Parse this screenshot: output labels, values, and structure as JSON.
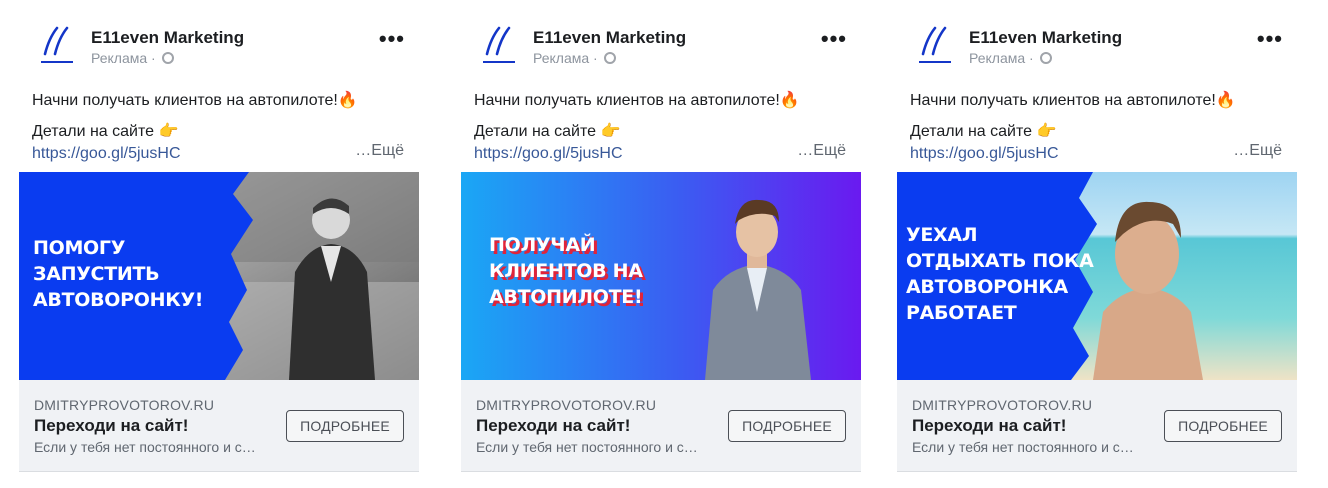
{
  "colors": {
    "brand_blue": "#0a3cf0",
    "link": "#385898",
    "secondary_text": "#606770",
    "cta_background": "#f0f2f5"
  },
  "ads": [
    {
      "advertiser": "E11even Marketing",
      "sponsored_label": "Реклама ·",
      "body_line1": "Начни получать клиентов на автопилоте!🔥",
      "body_line2": "Детали на сайте 👉",
      "link": "https://goo.gl/5jusHC",
      "see_more": "…Ещё",
      "image_headline": [
        "ПОМОГУ",
        "ЗАПУСТИТЬ",
        "АВТОВОРОНКУ!"
      ],
      "domain": "DMITRYPROVOTOROV.RU",
      "cta_title": "Переходи на сайт!",
      "cta_description": "Если у тебя нет постоянного и с…",
      "cta_button": "ПОДРОБНЕЕ",
      "more_icon": "ellipsis-icon"
    },
    {
      "advertiser": "E11even Marketing",
      "sponsored_label": "Реклама ·",
      "body_line1": "Начни получать клиентов на автопилоте!🔥",
      "body_line2": "Детали на сайте 👉",
      "link": "https://goo.gl/5jusHC",
      "see_more": "…Ещё",
      "image_headline": [
        "ПОЛУЧАЙ",
        "КЛИЕНТОВ НА",
        "АВТОПИЛОТЕ!"
      ],
      "domain": "DMITRYPROVOTOROV.RU",
      "cta_title": "Переходи на сайт!",
      "cta_description": "Если у тебя нет постоянного и с…",
      "cta_button": "ПОДРОБНЕЕ",
      "more_icon": "ellipsis-icon"
    },
    {
      "advertiser": "E11even Marketing",
      "sponsored_label": "Реклама ·",
      "body_line1": "Начни получать клиентов на автопилоте!🔥",
      "body_line2": "Детали на сайте 👉",
      "link": "https://goo.gl/5jusHC",
      "see_more": "…Ещё",
      "image_headline": [
        "УЕХАЛ",
        "ОТДЫХАТЬ ПОКА",
        "АВТОВОРОНКА",
        "РАБОТАЕТ"
      ],
      "domain": "DMITRYPROVOTOROV.RU",
      "cta_title": "Переходи на сайт!",
      "cta_description": "Если у тебя нет постоянного и с…",
      "cta_button": "ПОДРОБНЕЕ",
      "more_icon": "ellipsis-icon"
    }
  ]
}
